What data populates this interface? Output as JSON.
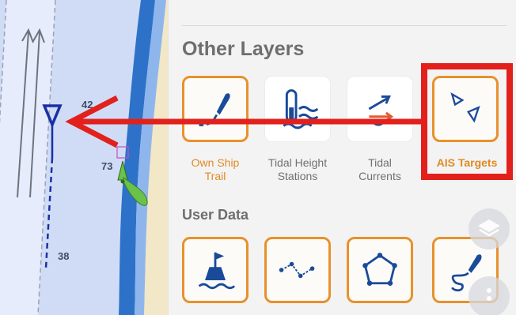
{
  "other_layers": {
    "title": "Other Layers",
    "items": [
      {
        "label_line1": "Own Ship",
        "label_line2": "Trail",
        "icon": "ship-trail-icon",
        "selected": true
      },
      {
        "label_line1": "Tidal Height",
        "label_line2": "Stations",
        "icon": "tide-gauge-icon",
        "selected": false
      },
      {
        "label_line1": "Tidal",
        "label_line2": "Currents",
        "icon": "tidal-current-icon",
        "selected": false
      },
      {
        "label_line1": "AIS Targets",
        "label_line2": "",
        "icon": "ais-targets-icon",
        "selected": true
      }
    ]
  },
  "user_data": {
    "title": "User Data",
    "items": [
      {
        "icon": "buoy-flag-icon"
      },
      {
        "icon": "route-icon"
      },
      {
        "icon": "area-polygon-icon"
      },
      {
        "icon": "track-icon"
      }
    ]
  },
  "map": {
    "depth_labels": [
      "42",
      "73",
      "38"
    ]
  },
  "colors": {
    "accent": "#e8912c",
    "highlight_red": "#e2201c",
    "icon_blue": "#1a4a9a",
    "water": "#cfdcf7",
    "land": "#f2e7c7"
  }
}
